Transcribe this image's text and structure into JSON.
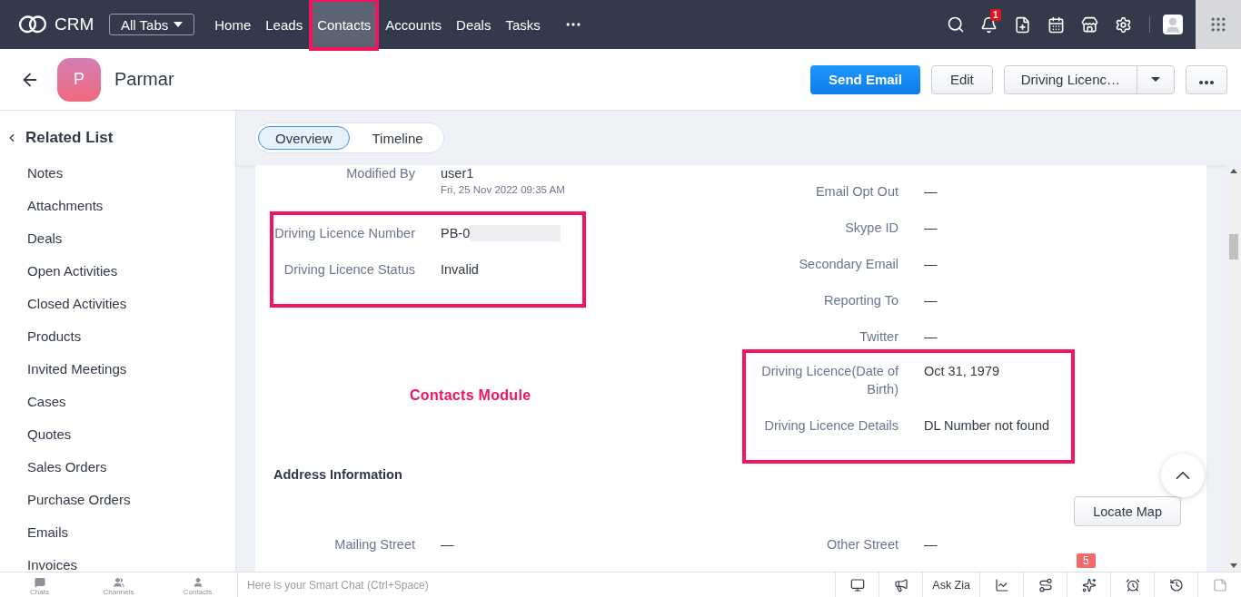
{
  "top_nav": {
    "logo_text": "CRM",
    "tabs_menu": "All Tabs",
    "items": [
      {
        "label": "Home",
        "selected": false,
        "highlighted": false
      },
      {
        "label": "Leads",
        "selected": false,
        "highlighted": false
      },
      {
        "label": "Contacts",
        "selected": true,
        "highlighted": true
      },
      {
        "label": "Accounts",
        "selected": false,
        "highlighted": false
      },
      {
        "label": "Deals",
        "selected": false,
        "highlighted": false
      },
      {
        "label": "Tasks",
        "selected": false,
        "highlighted": false
      }
    ],
    "notification_count": "1"
  },
  "record_header": {
    "avatar_letter": "P",
    "name": "Parmar",
    "buttons": [
      {
        "label": "Send Email",
        "kind": "primary"
      },
      {
        "label": "Edit",
        "kind": "secondary"
      },
      {
        "label": "Driving Licenc…",
        "kind": "split"
      },
      {
        "kind": "more"
      }
    ]
  },
  "sidebar": {
    "title": "Related List",
    "items": [
      "Notes",
      "Attachments",
      "Deals",
      "Open Activities",
      "Closed Activities",
      "Products",
      "Invited Meetings",
      "Cases",
      "Quotes",
      "Sales Orders",
      "Purchase Orders",
      "Emails",
      "Invoices"
    ]
  },
  "view_tabs": [
    {
      "label": "Overview",
      "selected": true
    },
    {
      "label": "Timeline",
      "selected": false
    }
  ],
  "details": {
    "left": [
      {
        "highlighted": false,
        "fields": [
          {
            "label": "Modified By",
            "value": "user1",
            "subtext": "Fri, 25 Nov 2022 09:35 AM"
          }
        ]
      },
      {
        "highlighted": true,
        "fields": [
          {
            "label": "Driving Licence Number",
            "value": "PB-0",
            "redacted": true
          },
          {
            "label": "Driving Licence Status",
            "value": "Invalid"
          }
        ]
      }
    ],
    "right": [
      {
        "highlighted": false,
        "fields": [
          {
            "label": "Email Opt Out",
            "value": "—"
          },
          {
            "label": "Skype ID",
            "value": "—"
          },
          {
            "label": "Secondary Email",
            "value": "—"
          },
          {
            "label": "Reporting To",
            "value": "—"
          },
          {
            "label": "Twitter",
            "value": "—"
          }
        ]
      },
      {
        "highlighted": true,
        "fields": [
          {
            "label": "Driving Licence(Date of Birth)",
            "value": "Oct 31, 1979"
          },
          {
            "label": "Driving Licence Details",
            "value": "DL Number not found"
          }
        ]
      }
    ],
    "annotation": "Contacts Module"
  },
  "address": {
    "title": "Address Information",
    "button": "Locate Map",
    "left": [
      {
        "label": "Mailing Street",
        "value": "—"
      }
    ],
    "right": [
      {
        "label": "Other Street",
        "value": "—"
      }
    ]
  },
  "bottom_bar": {
    "apps": [
      {
        "label": "Chats",
        "kind": "chats"
      },
      {
        "label": "Channels",
        "kind": "channels"
      },
      {
        "label": "Contacts",
        "kind": "contacts"
      }
    ],
    "chat_placeholder": "Here is your Smart Chat (Ctrl+Space)",
    "tools": [
      {
        "kind": "presence"
      },
      {
        "kind": "announce"
      },
      {
        "kind": "text",
        "label": "Ask Zia"
      },
      {
        "kind": "chart"
      },
      {
        "kind": "route"
      },
      {
        "kind": "zia",
        "badge": "5"
      },
      {
        "kind": "alarm"
      },
      {
        "kind": "history"
      },
      {
        "kind": "notes"
      }
    ]
  }
}
